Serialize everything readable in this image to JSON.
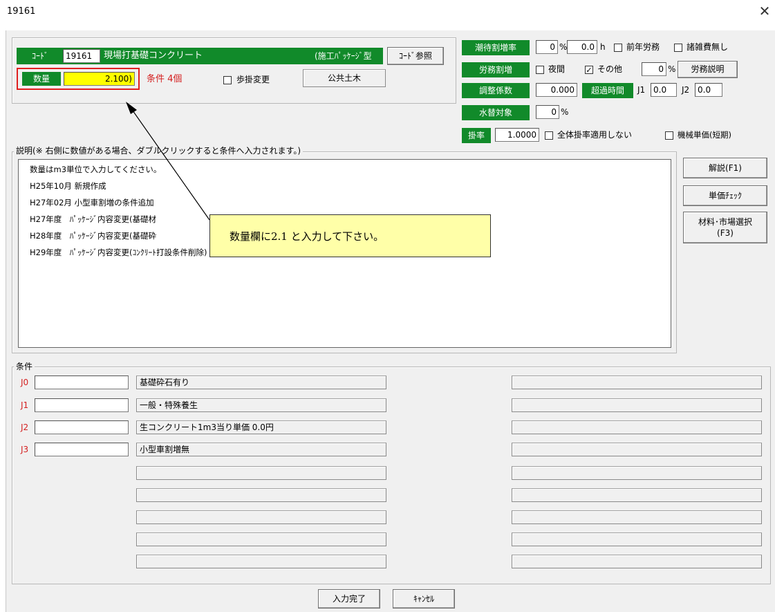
{
  "window": {
    "title": "19161",
    "close_label": "✕"
  },
  "header": {
    "code_label": "ｺｰﾄﾞ",
    "code_value": "19161",
    "item_name": "現場打基礎コンクリート",
    "package_label": "(施工ﾊﾟｯｹｰｼﾞ型",
    "code_ref_button": "ｺｰﾄﾞ参照",
    "quantity_label": "数量",
    "quantity_value": "2.100)",
    "conditions_count": "条件 4個",
    "step_change_label": "歩掛変更",
    "category": "公共土木"
  },
  "options": {
    "tide_rate_label": "潮待割増率",
    "tide_rate_pct": "0",
    "pct_unit": "%",
    "tide_hours": "0.0",
    "h_unit": "h",
    "prev_year_labor_label": "前年労務",
    "misc_cost_none_label": "諸雑費無し",
    "labor_extra_label": "労務割増",
    "night_label": "夜間",
    "other_label": "その他",
    "other_checked": true,
    "other_pct": "0",
    "labor_explain_button": "労務説明",
    "adjust_coef_label": "調整係数",
    "adjust_coef_value": "0.000",
    "overtime_label": "超過時間",
    "j1_label": "J1",
    "j1_value": "0.0",
    "j2_label": "J2",
    "j2_value": "0.0",
    "water_label": "水替対象",
    "water_pct": "0",
    "rate_label": "掛率",
    "rate_value": "1.0000",
    "no_global_rate_label": "全体掛率適用しない",
    "machine_unit_label": "機械単価(短期)"
  },
  "description": {
    "legend": "説明(※ 右側に数値がある場合、ダブルクリックすると条件へ入力されます。)",
    "lines": [
      "数量はm3単位で入力してください。",
      "H25年10月 新規作成",
      "H27年02月 小型車割増の条件追加",
      "H27年度　ﾊﾟｯｹｰｼﾞ内容変更(基礎材",
      "H28年度　ﾊﾟｯｹｰｼﾞ内容変更(基礎砕",
      "H29年度　ﾊﾟｯｹｰｼﾞ内容変更(ｺﾝｸﾘｰﾄ打設条件削除)"
    ]
  },
  "side_buttons": {
    "explain": "解説(F1)",
    "price_check": "単価ﾁｪｯｸ",
    "material_select": "材料･市場選択\n(F3)"
  },
  "callout": {
    "text": "数量欄に2.1 と入力して下さい。"
  },
  "conditions": {
    "legend": "条件",
    "rows": [
      {
        "code": "J0",
        "value": "",
        "desc": "基礎砕石有り"
      },
      {
        "code": "J1",
        "value": "",
        "desc": "一般・特殊養生"
      },
      {
        "code": "J2",
        "value": "",
        "desc": "生コンクリート1m3当り単価 0.0円"
      },
      {
        "code": "J3",
        "value": "",
        "desc": "小型車割増無"
      }
    ]
  },
  "footer": {
    "ok_button": "入力完了",
    "cancel_button": "ｷｬﾝｾﾙ"
  },
  "colors": {
    "accent_green": "#118a2a",
    "quantity_highlight": "#ffff00",
    "red_border": "#e02020",
    "callout_bg": "#ffffa8"
  }
}
